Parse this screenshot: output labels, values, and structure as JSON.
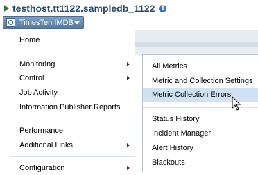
{
  "header": {
    "title": "testhost.tt1122.sampledb_1122",
    "info_icon": "info-icon"
  },
  "target_menu_button": {
    "label": "TimesTen IMDB",
    "icon": "target-icon"
  },
  "target_menu": {
    "items": [
      {
        "label": "Home",
        "submenu": false
      },
      {
        "label": "Monitoring",
        "submenu": true
      },
      {
        "label": "Control",
        "submenu": true
      },
      {
        "label": "Job Activity",
        "submenu": false
      },
      {
        "label": "Information Publisher Reports",
        "submenu": false
      },
      {
        "label": "Performance",
        "submenu": false
      },
      {
        "label": "Additional Links",
        "submenu": true
      },
      {
        "label": "Configuration",
        "submenu": true
      }
    ]
  },
  "monitoring_submenu": {
    "items": [
      {
        "label": "All Metrics"
      },
      {
        "label": "Metric and Collection Settings"
      },
      {
        "label": "Metric Collection Errors",
        "highlighted": true
      },
      {
        "label": "Status History"
      },
      {
        "label": "Incident Manager"
      },
      {
        "label": "Alert History"
      },
      {
        "label": "Blackouts"
      }
    ]
  },
  "colors": {
    "button_bg": "#6a8fb4",
    "highlight": "#cfe3f5",
    "title": "#2a4a6b"
  }
}
